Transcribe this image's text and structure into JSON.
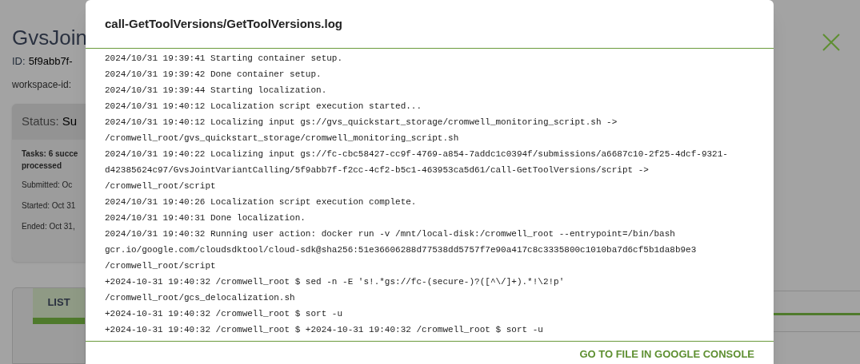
{
  "page": {
    "title": "GvsJoin",
    "id_label": "ID:",
    "id_value": "5f9abb7f-",
    "workspace_label": "workspace-id:",
    "status": {
      "label": "Status:",
      "value": "Su",
      "tasks": "Tasks: 6 succe",
      "tasks_2": "processed",
      "submitted": "Submitted: Oc",
      "started": "Started: Oct 31",
      "ended": "Ended: Oct 31,"
    },
    "tabs": [
      {
        "label": "LIST",
        "selected": true
      }
    ]
  },
  "modal": {
    "title": "call-GetToolVersions/GetToolVersions.log",
    "log": [
      "2024/10/31 19:39:41 Starting container setup.",
      "2024/10/31 19:39:42 Done container setup.",
      "2024/10/31 19:39:44 Starting localization.",
      "2024/10/31 19:40:12 Localization script execution started...",
      "2024/10/31 19:40:12 Localizing input gs://gvs_quickstart_storage/cromwell_monitoring_script.sh -> /cromwell_root/gvs_quickstart_storage/cromwell_monitoring_script.sh",
      "2024/10/31 19:40:22 Localizing input gs://fc-cbc58427-cc9f-4769-a854-7addc1c0394f/submissions/a6687c10-2f25-4dcf-9321-d42385624c97/GvsJointVariantCalling/5f9abb7f-f2cc-4cf2-b5c1-463953ca5d61/call-GetToolVersions/script -> /cromwell_root/script",
      "2024/10/31 19:40:26 Localization script execution complete.",
      "2024/10/31 19:40:31 Done localization.",
      "2024/10/31 19:40:32 Running user action: docker run -v /mnt/local-disk:/cromwell_root --entrypoint=/bin/bash gcr.io/google.com/cloudsdktool/cloud-sdk@sha256:51e36606288d77538dd5757f7e90a417c8c3335800c1010ba7d6cf5b1da8b9e3 /cromwell_root/script",
      "+2024-10-31 19:40:32 /cromwell_root $ sed -n -E 's!.*gs://fc-(secure-)?([^\\/]+).*!\\2!p' /cromwell_root/gcs_delocalization.sh",
      "+2024-10-31 19:40:32 /cromwell_root $ sort -u",
      "+2024-10-31 19:40:32 /cromwell_root $ +2024-10-31 19:40:32 /cromwell_root $ sort -u"
    ],
    "link": "GO TO FILE IN GOOGLE CONSOLE"
  }
}
